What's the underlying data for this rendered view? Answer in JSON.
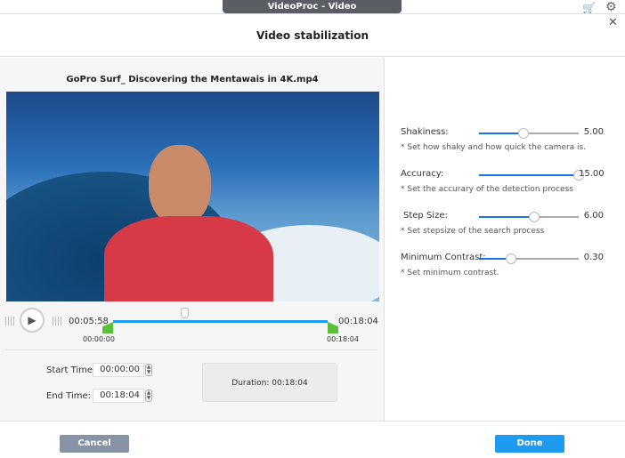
{
  "window": {
    "title": "VideoProc - Video"
  },
  "dialog": {
    "title": "Video stabilization"
  },
  "preview": {
    "filename": "GoPro Surf_ Discovering the Mentawais in 4K.mp4"
  },
  "timeline": {
    "current": "00:05:58",
    "end_label": "00:18:04",
    "start_marker": "00:00:00",
    "end_marker": "00:18:04",
    "progress_fraction": 0.33
  },
  "times": {
    "start_label": "Start Time:",
    "start_value": "00:00:00",
    "end_label": "End Time:",
    "end_value": "00:18:04",
    "duration_label": "Duration:",
    "duration_value": "00:18:04"
  },
  "settings": [
    {
      "label": "Shakiness:",
      "value": "5.00",
      "fraction": 0.45,
      "hint": "* Set how shaky and how quick the camera is."
    },
    {
      "label": "Accuracy:",
      "value": "15.00",
      "fraction": 1.0,
      "hint": "* Set the accurary of the detection process"
    },
    {
      "label": "Step Size:",
      "value": "6.00",
      "fraction": 0.55,
      "hint": "* Set stepsize of the search process"
    },
    {
      "label": "Minimum Contrast:",
      "value": "0.30",
      "fraction": 0.32,
      "hint": "* Set minimum contrast."
    }
  ],
  "buttons": {
    "cancel": "Cancel",
    "done": "Done"
  },
  "colors": {
    "accent": "#1a73e8",
    "done": "#1e9af0",
    "cancel": "#8893a6",
    "trim": "#5cbf3a",
    "cart": "#e53935"
  }
}
